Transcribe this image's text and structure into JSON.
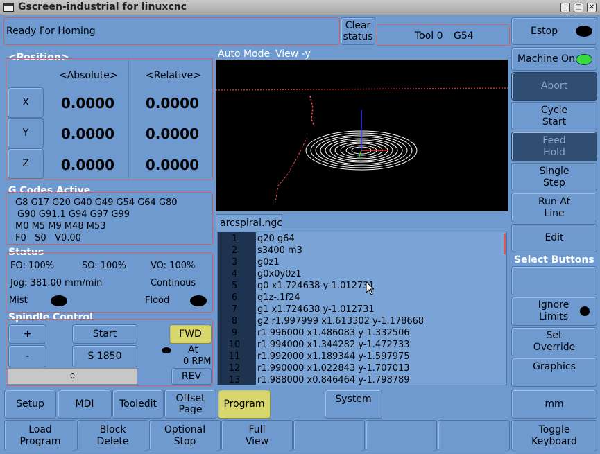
{
  "window": {
    "title": "Gscreen-industrial for linuxcnc",
    "controls": [
      "_",
      "□",
      "✕"
    ]
  },
  "status": {
    "message": "Ready For Homing",
    "clear_label": "Clear status",
    "tool": "Tool 0",
    "coord_system": "G54"
  },
  "right_buttons": {
    "estop": "Estop",
    "machine_on": "Machine On",
    "abort": "Abort",
    "cycle_start": "Cycle Start",
    "feed_hold": "Feed Hold",
    "single_step": "Single Step",
    "run_at_line": "Run At Line",
    "edit": "Edit",
    "select_buttons": "Select Buttons",
    "ignore_limits": "Ignore Limits",
    "set_override": "Set Override",
    "graphics": "Graphics",
    "mm": "mm",
    "toggle_keyboard": "Toggle Keyboard"
  },
  "position": {
    "title": "<Position>",
    "absolute_hdr": "<Absolute>",
    "relative_hdr": "<Relative>",
    "axes": [
      {
        "label": "X",
        "abs": "0.0000",
        "rel": "0.0000"
      },
      {
        "label": "Y",
        "abs": "0.0000",
        "rel": "0.0000"
      },
      {
        "label": "Z",
        "abs": "0.0000",
        "rel": "0.0000"
      }
    ]
  },
  "gcodes": {
    "title": "G Codes Active",
    "lines": [
      "G8 G17 G20 G40 G49 G54 G64 G80",
      "G90 G91.1 G94 G97 G99",
      "M0 M5 M9 M48 M53",
      "F0   S0   V0.00"
    ]
  },
  "status_panel": {
    "title": "Status",
    "fo": "FO: 100%",
    "so": "SO: 100%",
    "vo": "VO: 100%",
    "jog": "Jog: 381.00 mm/min",
    "continuous": "Continous",
    "mist": "Mist",
    "flood": "Flood"
  },
  "spindle": {
    "title": "Spindle Control",
    "plus": "+",
    "minus": "-",
    "start": "Start",
    "speed": "S 1850",
    "fwd": "FWD",
    "rev": "REV",
    "at": "At",
    "rpm": "0 RPM",
    "bar_value": "0"
  },
  "view": {
    "mode": "Auto Mode",
    "view": "View -y"
  },
  "file": {
    "name": "arcspiral.ngc",
    "lines": [
      {
        "n": "1",
        "t": "g20 g64"
      },
      {
        "n": "2",
        "t": "s3400 m3"
      },
      {
        "n": "3",
        "t": "g0z1"
      },
      {
        "n": "4",
        "t": "g0x0y0z1"
      },
      {
        "n": "5",
        "t": "g0 x1.724638 y-1.012731"
      },
      {
        "n": "6",
        "t": "g1z-.1f24"
      },
      {
        "n": "7",
        "t": "g1 x1.724638 y-1.012731"
      },
      {
        "n": "8",
        "t": "g2 r1.997999 x1.613302 y-1.178668"
      },
      {
        "n": "9",
        "t": "r1.996000 x1.486083 y-1.332506"
      },
      {
        "n": "10",
        "t": "r1.994000 x1.344282 y-1.472733"
      },
      {
        "n": "11",
        "t": "r1.992000 x1.189344 y-1.597975"
      },
      {
        "n": "12",
        "t": "r1.990000 x1.022843 y-1.707013"
      },
      {
        "n": "13",
        "t": "r1.988000 x0.846464 y-1.798789"
      }
    ]
  },
  "bottom_tabs": {
    "setup": "Setup",
    "mdi": "MDI",
    "tooledit": "Tooledit",
    "offset_page": "Offset Page",
    "program": "Program",
    "system": "System"
  },
  "bottom_buttons": {
    "load_program": "Load Program",
    "block_delete": "Block Delete",
    "optional_stop": "Optional Stop",
    "full_view": "Full View"
  }
}
